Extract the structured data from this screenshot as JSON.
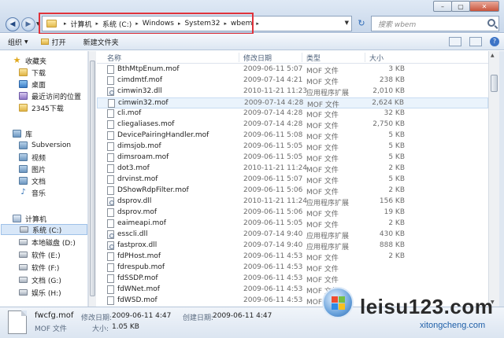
{
  "window": {
    "minimize": "–",
    "maximize": "▢",
    "close": "✕"
  },
  "nav_buttons": {
    "back": "◀",
    "forward": "▶"
  },
  "address": {
    "crumbs": [
      "计算机",
      "系统 (C:)",
      "Windows",
      "System32",
      "wbem"
    ],
    "separator": "▸"
  },
  "search": {
    "placeholder": "搜索 wbem"
  },
  "toolbar": {
    "organize": "组织",
    "open": "打开",
    "new_folder": "新建文件夹"
  },
  "sidebar": {
    "favorites": {
      "label": "收藏夹",
      "items": [
        "下载",
        "桌面",
        "最近访问的位置",
        "2345下载"
      ]
    },
    "libraries": {
      "label": "库",
      "items": [
        "Subversion",
        "视频",
        "图片",
        "文档",
        "音乐"
      ]
    },
    "computer": {
      "label": "计算机",
      "items": [
        "系统 (C:)",
        "本地磁盘 (D:)",
        "软件 (E:)",
        "软件 (F:)",
        "文档 (G:)",
        "娱乐 (H:)"
      ]
    }
  },
  "columns": {
    "name": "名称",
    "date": "修改日期",
    "type": "类型",
    "size": "大小"
  },
  "files": [
    {
      "name": "BthMtpEnum.mof",
      "date": "2009-06-11 5:07",
      "type": "MOF 文件",
      "size": "3 KB"
    },
    {
      "name": "cimdmtf.mof",
      "date": "2009-07-14 4:21",
      "type": "MOF 文件",
      "size": "238 KB"
    },
    {
      "name": "cimwin32.dll",
      "date": "2010-11-21 11:23",
      "type": "应用程序扩展",
      "size": "2,010 KB"
    },
    {
      "name": "cimwin32.mof",
      "date": "2009-07-14 4:28",
      "type": "MOF 文件",
      "size": "2,624 KB"
    },
    {
      "name": "cli.mof",
      "date": "2009-07-14 4:28",
      "type": "MOF 文件",
      "size": "32 KB"
    },
    {
      "name": "cliegaliases.mof",
      "date": "2009-07-14 4:28",
      "type": "MOF 文件",
      "size": "2,750 KB"
    },
    {
      "name": "DevicePairingHandler.mof",
      "date": "2009-06-11 5:08",
      "type": "MOF 文件",
      "size": "5 KB"
    },
    {
      "name": "dimsjob.mof",
      "date": "2009-06-11 5:05",
      "type": "MOF 文件",
      "size": "5 KB"
    },
    {
      "name": "dimsroam.mof",
      "date": "2009-06-11 5:05",
      "type": "MOF 文件",
      "size": "5 KB"
    },
    {
      "name": "dot3.mof",
      "date": "2010-11-21 11:24",
      "type": "MOF 文件",
      "size": "2 KB"
    },
    {
      "name": "drvinst.mof",
      "date": "2009-06-11 5:07",
      "type": "MOF 文件",
      "size": "5 KB"
    },
    {
      "name": "DShowRdpFilter.mof",
      "date": "2009-06-11 5:06",
      "type": "MOF 文件",
      "size": "2 KB"
    },
    {
      "name": "dsprov.dll",
      "date": "2010-11-21 11:24",
      "type": "应用程序扩展",
      "size": "156 KB"
    },
    {
      "name": "dsprov.mof",
      "date": "2009-06-11 5:06",
      "type": "MOF 文件",
      "size": "19 KB"
    },
    {
      "name": "eaimeapi.mof",
      "date": "2009-06-11 5:05",
      "type": "MOF 文件",
      "size": "2 KB"
    },
    {
      "name": "esscli.dll",
      "date": "2009-07-14 9:40",
      "type": "应用程序扩展",
      "size": "430 KB"
    },
    {
      "name": "fastprox.dll",
      "date": "2009-07-14 9:40",
      "type": "应用程序扩展",
      "size": "888 KB"
    },
    {
      "name": "fdPHost.mof",
      "date": "2009-06-11 4:53",
      "type": "MOF 文件",
      "size": "2 KB"
    },
    {
      "name": "fdrespub.mof",
      "date": "2009-06-11 4:53",
      "type": "MOF 文件",
      "size": ""
    },
    {
      "name": "fdSSDP.mof",
      "date": "2009-06-11 4:53",
      "type": "MOF 文件",
      "size": ""
    },
    {
      "name": "fdWNet.mof",
      "date": "2009-06-11 4:53",
      "type": "MOF 文件",
      "size": ""
    },
    {
      "name": "fdWSD.mof",
      "date": "2009-06-11 4:53",
      "type": "MOF 文件",
      "size": ""
    }
  ],
  "details": {
    "name": "fwcfg.mof",
    "date_label": "修改日期:",
    "date": "2009-06-11 4:47",
    "created_label": "创建日期:",
    "created": "2009-06-11 4:47",
    "type": "MOF 文件",
    "size_label": "大小:",
    "size": "1.05 KB"
  },
  "watermark": {
    "main": "leisu123.com",
    "sub": "xitongcheng.com"
  }
}
